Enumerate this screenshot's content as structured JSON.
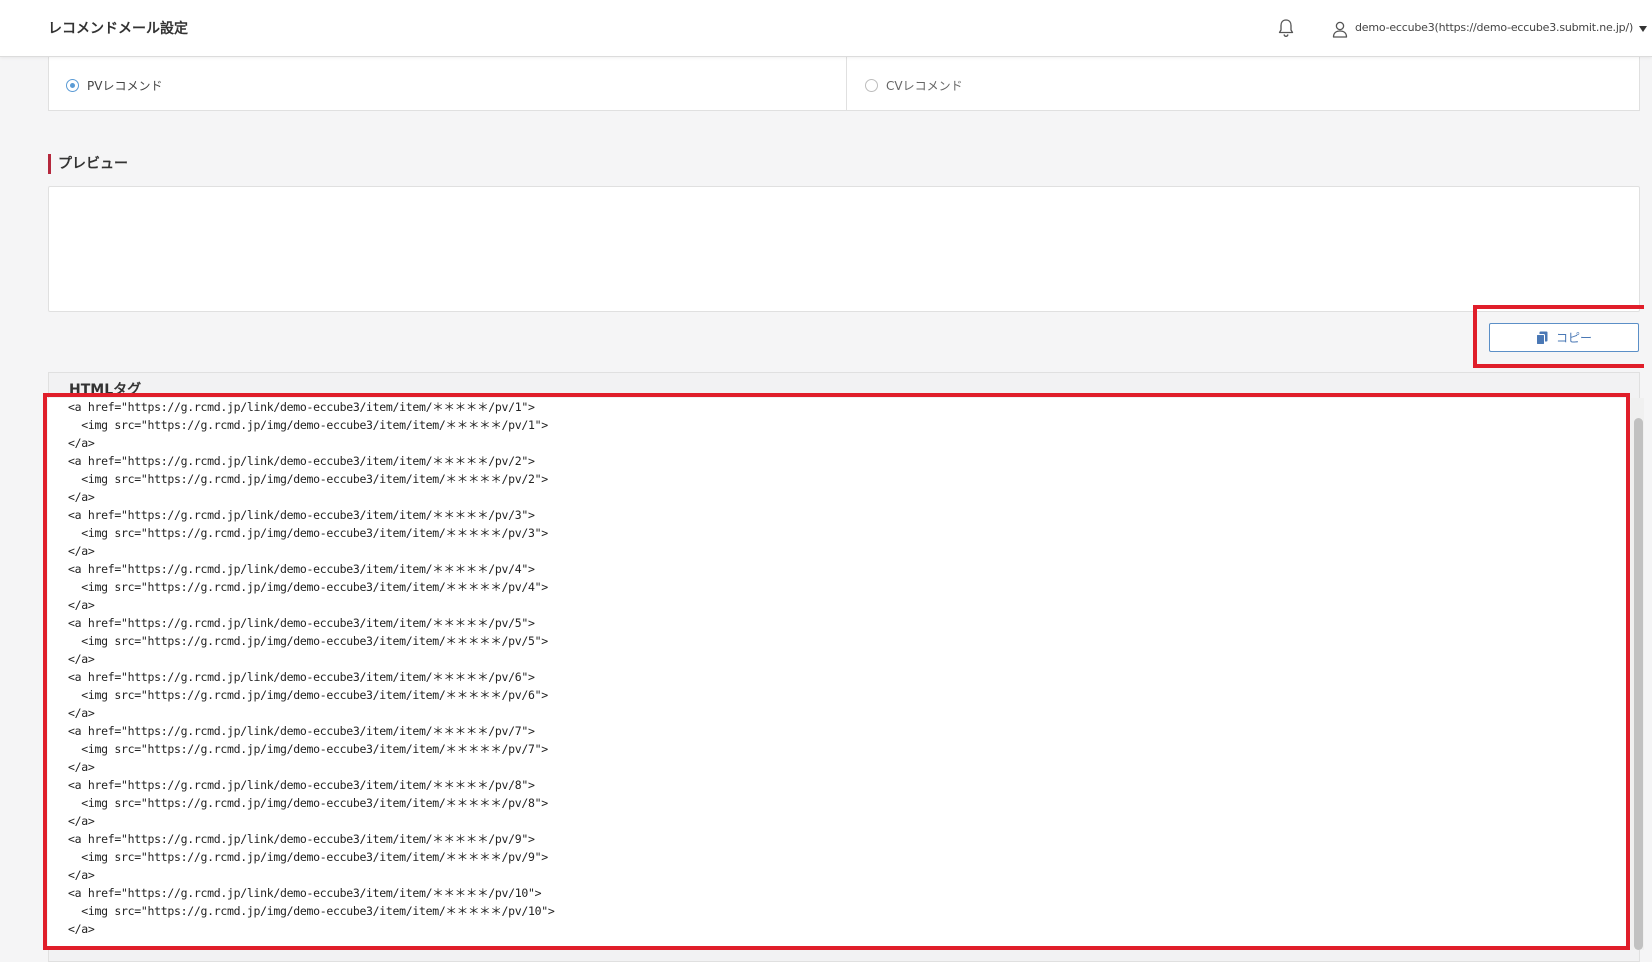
{
  "header": {
    "title": "レコメンドメール設定",
    "user_label": "demo-eccube3(https://demo-eccube3.submit.ne.jp/)",
    "icons": [
      "bell-icon",
      "user-icon",
      "caret-down-icon"
    ]
  },
  "recommend_type": {
    "options": [
      {
        "label": "PVレコメンド",
        "checked": true
      },
      {
        "label": "CVレコメンド",
        "checked": false
      }
    ]
  },
  "preview": {
    "heading": "プレビュー"
  },
  "copy_button": {
    "label": "コピー",
    "icon": "copy-icon"
  },
  "html_tag": {
    "title": "HTMLタグ",
    "lines": [
      "<a href=\"https://g.rcmd.jp/link/demo-eccube3/item/item/＊＊＊＊＊/pv/1\">",
      "  <img src=\"https://g.rcmd.jp/img/demo-eccube3/item/item/＊＊＊＊＊/pv/1\">",
      "</a>",
      "<a href=\"https://g.rcmd.jp/link/demo-eccube3/item/item/＊＊＊＊＊/pv/2\">",
      "  <img src=\"https://g.rcmd.jp/img/demo-eccube3/item/item/＊＊＊＊＊/pv/2\">",
      "</a>",
      "<a href=\"https://g.rcmd.jp/link/demo-eccube3/item/item/＊＊＊＊＊/pv/3\">",
      "  <img src=\"https://g.rcmd.jp/img/demo-eccube3/item/item/＊＊＊＊＊/pv/3\">",
      "</a>",
      "<a href=\"https://g.rcmd.jp/link/demo-eccube3/item/item/＊＊＊＊＊/pv/4\">",
      "  <img src=\"https://g.rcmd.jp/img/demo-eccube3/item/item/＊＊＊＊＊/pv/4\">",
      "</a>",
      "<a href=\"https://g.rcmd.jp/link/demo-eccube3/item/item/＊＊＊＊＊/pv/5\">",
      "  <img src=\"https://g.rcmd.jp/img/demo-eccube3/item/item/＊＊＊＊＊/pv/5\">",
      "</a>",
      "<a href=\"https://g.rcmd.jp/link/demo-eccube3/item/item/＊＊＊＊＊/pv/6\">",
      "  <img src=\"https://g.rcmd.jp/img/demo-eccube3/item/item/＊＊＊＊＊/pv/6\">",
      "</a>",
      "<a href=\"https://g.rcmd.jp/link/demo-eccube3/item/item/＊＊＊＊＊/pv/7\">",
      "  <img src=\"https://g.rcmd.jp/img/demo-eccube3/item/item/＊＊＊＊＊/pv/7\">",
      "</a>",
      "<a href=\"https://g.rcmd.jp/link/demo-eccube3/item/item/＊＊＊＊＊/pv/8\">",
      "  <img src=\"https://g.rcmd.jp/img/demo-eccube3/item/item/＊＊＊＊＊/pv/8\">",
      "</a>",
      "<a href=\"https://g.rcmd.jp/link/demo-eccube3/item/item/＊＊＊＊＊/pv/9\">",
      "  <img src=\"https://g.rcmd.jp/img/demo-eccube3/item/item/＊＊＊＊＊/pv/9\">",
      "</a>",
      "<a href=\"https://g.rcmd.jp/link/demo-eccube3/item/item/＊＊＊＊＊/pv/10\">",
      "  <img src=\"https://g.rcmd.jp/img/demo-eccube3/item/item/＊＊＊＊＊/pv/10\">",
      "</a>"
    ]
  },
  "colors": {
    "accent_bar": "#b5283d",
    "highlight_frame": "#e01e2a",
    "button_border": "#5b8fc7",
    "radio_checked": "#5b9bd5"
  }
}
